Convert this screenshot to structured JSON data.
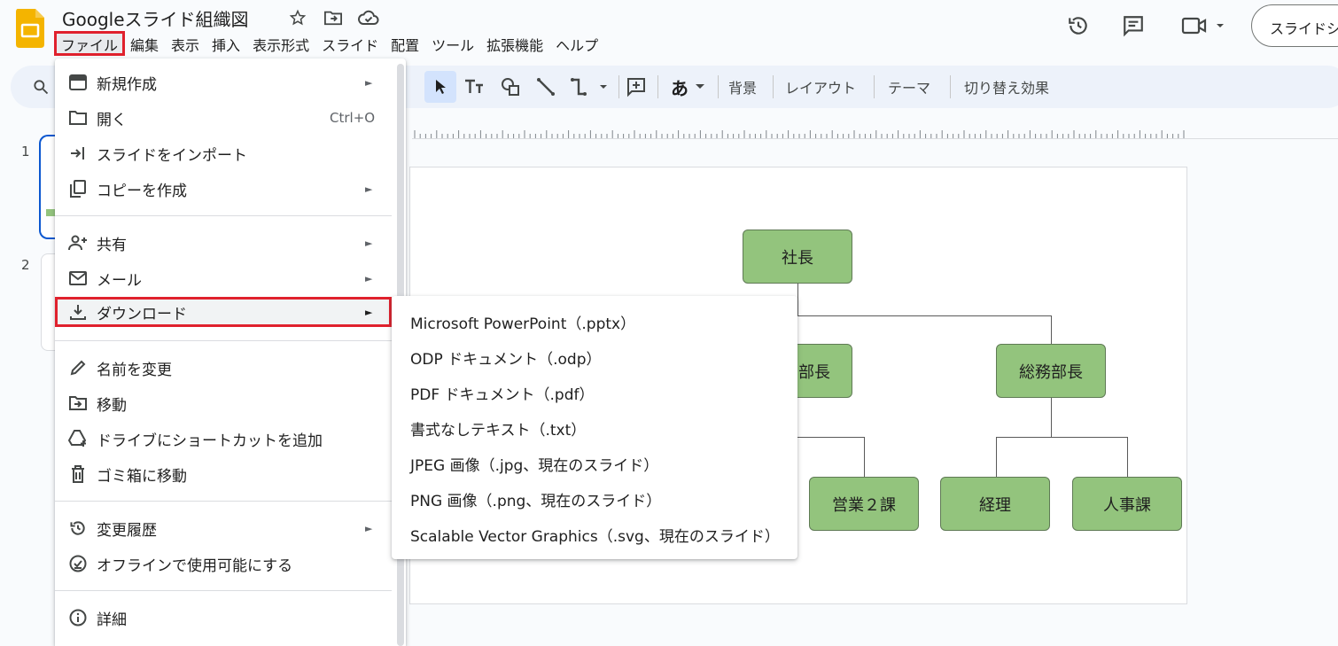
{
  "doc": {
    "title": "Googleスライド組織図"
  },
  "menubar": [
    "ファイル",
    "編集",
    "表示",
    "挿入",
    "表示形式",
    "スライド",
    "配置",
    "ツール",
    "拡張機能",
    "ヘルプ"
  ],
  "header": {
    "share_label": "スライドショー"
  },
  "toolbar": {
    "background": "背景",
    "layout": "レイアウト",
    "theme": "テーマ",
    "transition": "切り替え効果",
    "font_glyph": "あ"
  },
  "filmstrip": {
    "slides": [
      "1",
      "2"
    ]
  },
  "org_chart": {
    "ceo": "社長",
    "dept_left": "部長",
    "dept_right": "総務部長",
    "sales2": "営業２課",
    "accounting": "経理",
    "hr": "人事課"
  },
  "file_menu": {
    "items": [
      {
        "label": "新規作成",
        "icon": "slides-icon",
        "submenu": true
      },
      {
        "label": "開く",
        "icon": "folder-icon",
        "shortcut": "Ctrl+O"
      },
      {
        "label": "スライドをインポート",
        "icon": "import-icon"
      },
      {
        "label": "コピーを作成",
        "icon": "copy-icon",
        "submenu": true
      },
      {
        "label": "共有",
        "icon": "person-add-icon",
        "submenu": true
      },
      {
        "label": "メール",
        "icon": "mail-icon",
        "submenu": true
      },
      {
        "label": "ダウンロード",
        "icon": "download-icon",
        "submenu": true
      },
      {
        "label": "名前を変更",
        "icon": "pencil-icon"
      },
      {
        "label": "移動",
        "icon": "move-folder-icon"
      },
      {
        "label": "ドライブにショートカットを追加",
        "icon": "drive-shortcut-icon"
      },
      {
        "label": "ゴミ箱に移動",
        "icon": "trash-icon"
      },
      {
        "label": "変更履歴",
        "icon": "history-icon",
        "submenu": true
      },
      {
        "label": "オフラインで使用可能にする",
        "icon": "offline-icon"
      },
      {
        "label": "詳細",
        "icon": "info-icon"
      }
    ],
    "arrow_glyph": "►"
  },
  "download_submenu": {
    "items": [
      "Microsoft PowerPoint（.pptx）",
      "ODP ドキュメント（.odp）",
      "PDF ドキュメント（.pdf）",
      "書式なしテキスト（.txt）",
      "JPEG 画像（.jpg、現在のスライド）",
      "PNG 画像（.png、現在のスライド）",
      "Scalable Vector Graphics（.svg、現在のスライド）"
    ]
  },
  "colors": {
    "highlight": "#e0212d",
    "node_fill": "#93c47d",
    "slides_logo": "#f4b400",
    "selection": "#0b57d0"
  }
}
